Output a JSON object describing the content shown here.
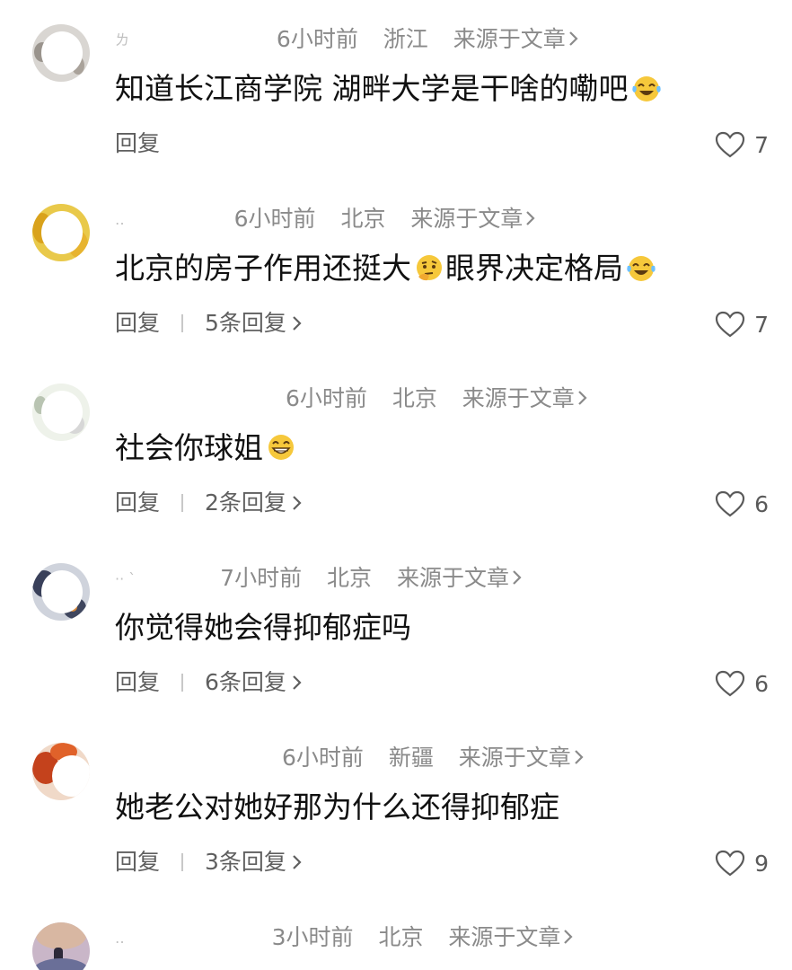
{
  "comments": [
    {
      "time": "6小时前",
      "location": "浙江",
      "source": "来源于文章",
      "text": "知道长江商学院 湖畔大学是干啥的嘞吧",
      "emoji": "laugh-cry",
      "reply_label": "回复",
      "replies_text": "",
      "likes": "7",
      "name_smudge": "ㄌ"
    },
    {
      "time": "6小时前",
      "location": "北京",
      "source": "来源于文章",
      "text": "北京的房子作用还挺大",
      "emoji_mid": "thinking",
      "text2": "眼界决定格局",
      "emoji": "laugh-cry",
      "reply_label": "回复",
      "replies_text": "5条回复",
      "likes": "7",
      "name_smudge": "‥"
    },
    {
      "time": "6小时前",
      "location": "北京",
      "source": "来源于文章",
      "text": "社会你球姐",
      "emoji": "grin",
      "reply_label": "回复",
      "replies_text": "2条回复",
      "likes": "6",
      "name_smudge": ""
    },
    {
      "time": "7小时前",
      "location": "北京",
      "source": "来源于文章",
      "text": "你觉得她会得抑郁症吗",
      "emoji": "",
      "reply_label": "回复",
      "replies_text": "6条回复",
      "likes": "6",
      "name_smudge": "··  `"
    },
    {
      "time": "6小时前",
      "location": "新疆",
      "source": "来源于文章",
      "text": "她老公对她好那为什么还得抑郁症",
      "emoji": "",
      "reply_label": "回复",
      "replies_text": "3条回复",
      "likes": "9",
      "name_smudge": ""
    },
    {
      "time": "3小时前",
      "location": "北京",
      "source": "来源于文章",
      "text": "",
      "emoji": "",
      "reply_label": "",
      "replies_text": "",
      "likes": "",
      "name_smudge": "‥"
    }
  ],
  "colors": {
    "meta": "#8a8a8a",
    "text": "#111111",
    "action": "#5f5f5f",
    "heart_stroke": "#5a5a5a",
    "emoji_face": "#f6c83b"
  },
  "icons": {
    "chevron": "chevron-right-icon",
    "heart": "heart-outline-icon",
    "emoji_laugh_cry": "face-tears-of-joy-icon",
    "emoji_thinking": "thinking-face-icon",
    "emoji_grin": "grinning-face-icon"
  }
}
